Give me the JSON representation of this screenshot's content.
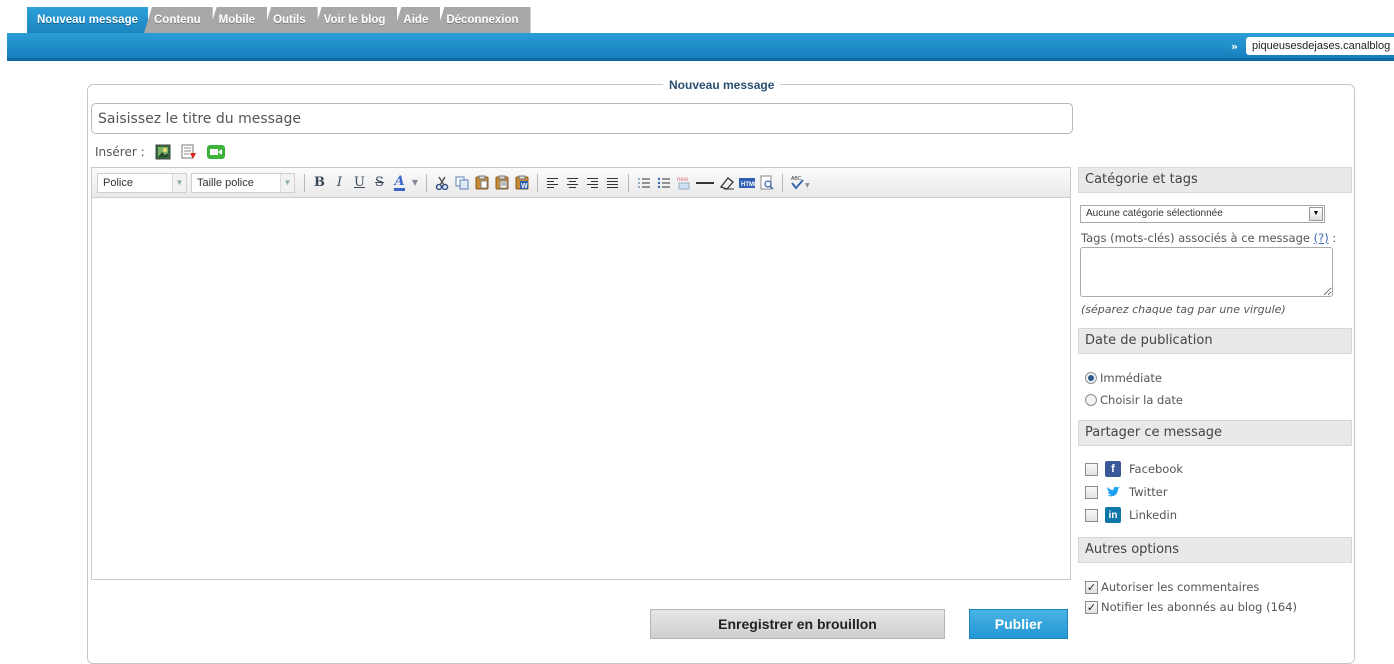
{
  "nav": {
    "tabs": [
      {
        "label": "Nouveau message",
        "active": true
      },
      {
        "label": "Contenu"
      },
      {
        "label": "Mobile"
      },
      {
        "label": "Outils"
      },
      {
        "label": "Voir le blog"
      },
      {
        "label": "Aide"
      },
      {
        "label": "Déconnexion"
      }
    ],
    "site_marker": "»",
    "site_name": "piqueusesdejases.canalblog"
  },
  "form": {
    "legend": "Nouveau message",
    "title_placeholder": "Saisissez le titre du message",
    "insert_label": "Insérer :",
    "insert_icons": [
      "image-icon",
      "document-icon",
      "video-icon"
    ]
  },
  "editor": {
    "font_select": "Police",
    "size_select": "Taille police",
    "toolbar_icons": [
      "bold",
      "italic",
      "underline",
      "strikethrough",
      "text-color",
      "cut",
      "copy",
      "paste",
      "paste-text",
      "paste-word",
      "align-left",
      "align-center",
      "align-right",
      "justify",
      "ordered-list",
      "unordered-list",
      "new-document",
      "horizontal-rule",
      "eraser",
      "html-source",
      "preview",
      "spellcheck"
    ]
  },
  "buttons": {
    "draft": "Enregistrer en brouillon",
    "publish": "Publier"
  },
  "sidebar": {
    "category": {
      "heading": "Catégorie et tags",
      "select_value": "Aucune catégorie sélectionnée",
      "tags_label": "Tags (mots-clés) associés à ce message",
      "tags_help": "(?)",
      "tags_colon": " :",
      "tags_hint": "(séparez chaque tag par une virgule)"
    },
    "date": {
      "heading": "Date de publication",
      "options": [
        {
          "label": "Immédiate",
          "selected": true
        },
        {
          "label": "Choisir la date",
          "selected": false
        }
      ]
    },
    "share": {
      "heading": "Partager ce message",
      "networks": [
        {
          "label": "Facebook",
          "checked": false,
          "color": "#3b5998"
        },
        {
          "label": "Twitter",
          "checked": false,
          "color": "#1da1f2"
        },
        {
          "label": "Linkedin",
          "checked": false,
          "color": "#0e76a8"
        }
      ]
    },
    "other": {
      "heading": "Autres options",
      "options": [
        {
          "label": "Autoriser les commentaires",
          "checked": true
        },
        {
          "label": "Notifier les abonnés au blog (164)",
          "checked": true
        }
      ]
    }
  }
}
